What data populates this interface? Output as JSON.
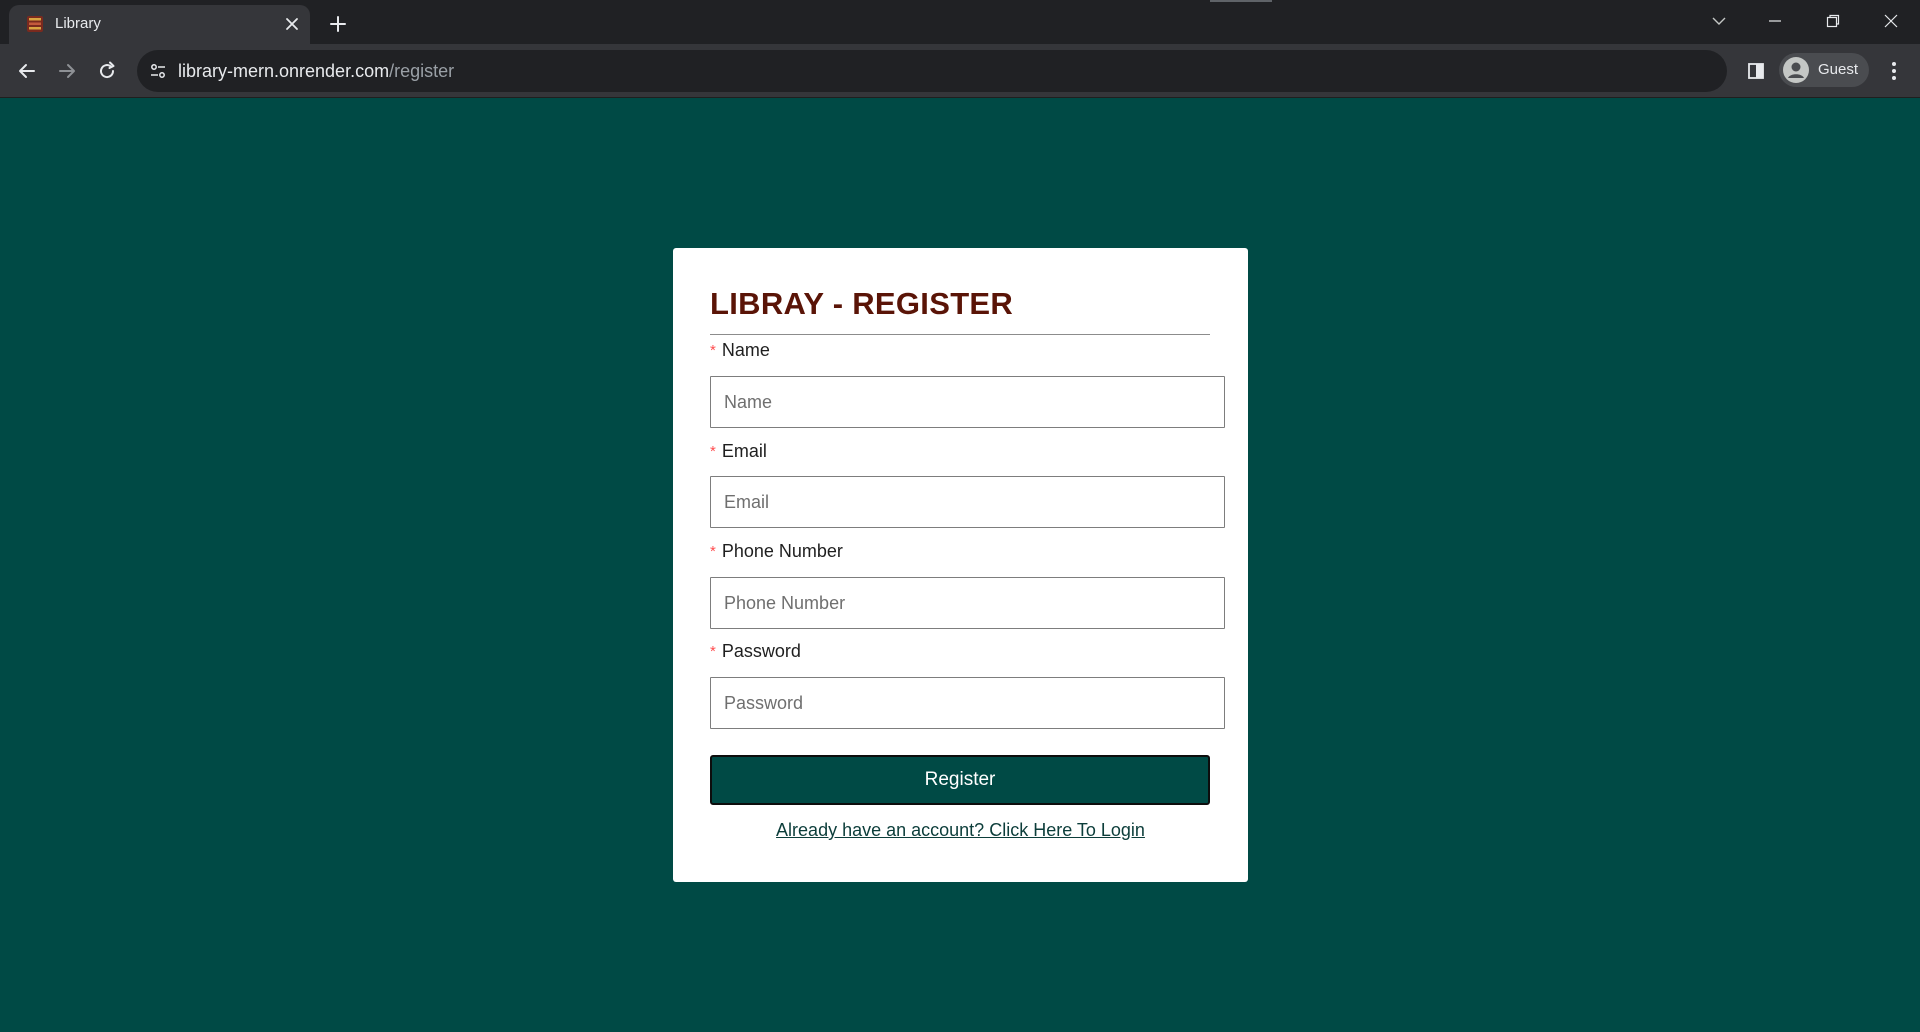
{
  "browser": {
    "tab_title": "Library",
    "url_host": "library-mern.onrender.com",
    "url_path": "/register",
    "profile_label": "Guest"
  },
  "colors": {
    "page_background": "#004a45",
    "title_color": "#5a1407",
    "button_background": "#004a45",
    "required_marker": "#ff4d4f"
  },
  "form": {
    "title": "LIBRAY - REGISTER",
    "required_marker": "*",
    "fields": [
      {
        "label": "Name",
        "placeholder": "Name",
        "value": ""
      },
      {
        "label": "Email",
        "placeholder": "Email",
        "value": ""
      },
      {
        "label": "Phone Number",
        "placeholder": "Phone Number",
        "value": ""
      },
      {
        "label": "Password",
        "placeholder": "Password",
        "value": ""
      }
    ],
    "submit_label": "Register",
    "login_link": "Already have an account? Click Here To Login"
  },
  "icons": {
    "favicon": "books-favicon-icon",
    "tab_close": "close-icon",
    "new_tab": "plus-icon",
    "back": "arrow-left-icon",
    "forward": "arrow-right-icon",
    "reload": "reload-icon",
    "site_info": "site-settings-icon",
    "side_panel": "side-panel-icon",
    "profile": "account-circle-icon",
    "menu": "kebab-menu-icon",
    "tab_search": "chevron-down-icon",
    "minimize": "minimize-icon",
    "maximize": "restore-icon",
    "close_window": "close-icon"
  }
}
